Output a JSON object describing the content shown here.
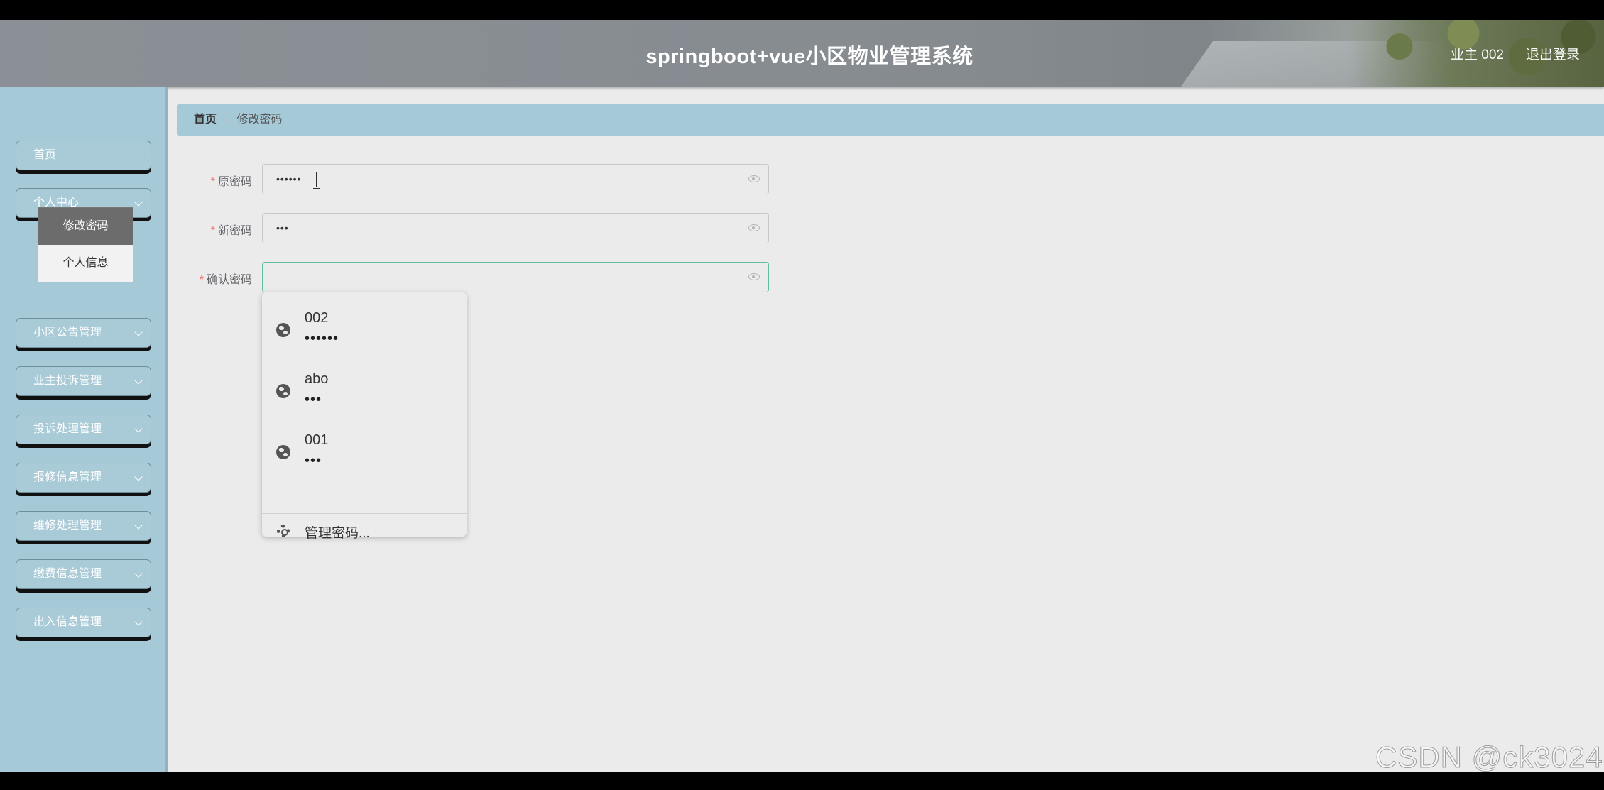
{
  "header": {
    "title": "springboot+vue小区物业管理系统",
    "user_label": "业主 002",
    "logout_label": "退出登录"
  },
  "sidebar": {
    "items": [
      {
        "label": "首页",
        "expandable": false
      },
      {
        "label": "个人中心",
        "expandable": true,
        "expanded": true,
        "children": [
          {
            "label": "修改密码",
            "active": true
          },
          {
            "label": "个人信息",
            "active": false
          }
        ]
      },
      {
        "label": "小区公告管理",
        "expandable": true
      },
      {
        "label": "业主投诉管理",
        "expandable": true
      },
      {
        "label": "投诉处理管理",
        "expandable": true
      },
      {
        "label": "报修信息管理",
        "expandable": true
      },
      {
        "label": "维修处理管理",
        "expandable": true
      },
      {
        "label": "缴费信息管理",
        "expandable": true
      },
      {
        "label": "出入信息管理",
        "expandable": true
      }
    ]
  },
  "breadcrumb": {
    "home": "首页",
    "separator": "/",
    "current": "修改密码"
  },
  "form": {
    "required_mark": "*",
    "fields": [
      {
        "label": "原密码",
        "value": "••••••",
        "focused": false
      },
      {
        "label": "新密码",
        "value": "•••",
        "focused": false
      },
      {
        "label": "确认密码",
        "value": "",
        "focused": true
      }
    ]
  },
  "autofill": {
    "entries": [
      {
        "username": "002",
        "password_mask": "••••••"
      },
      {
        "username": "abo",
        "password_mask": "•••"
      },
      {
        "username": "001",
        "password_mask": "•••"
      }
    ],
    "manage_label": "管理密码..."
  },
  "watermark": "CSDN @ck3024",
  "colors": {
    "sidebar_bg": "#a5c9d7",
    "breadcrumb_bg": "#a5c9d7",
    "content_bg": "#ebebeb",
    "required": "#f56c6c",
    "focus_border": "#5fbfa0"
  }
}
